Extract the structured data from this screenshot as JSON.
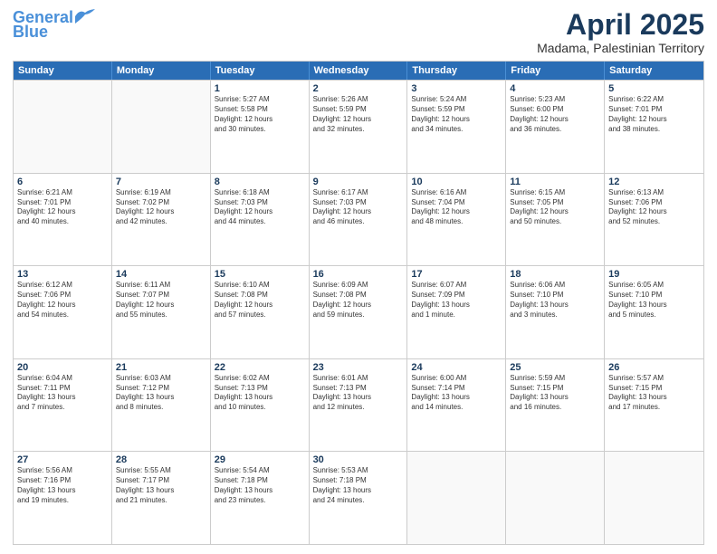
{
  "header": {
    "logo_line1": "General",
    "logo_line2": "Blue",
    "month_year": "April 2025",
    "location": "Madama, Palestinian Territory"
  },
  "days_of_week": [
    "Sunday",
    "Monday",
    "Tuesday",
    "Wednesday",
    "Thursday",
    "Friday",
    "Saturday"
  ],
  "weeks": [
    [
      {
        "day": "",
        "lines": []
      },
      {
        "day": "",
        "lines": []
      },
      {
        "day": "1",
        "lines": [
          "Sunrise: 5:27 AM",
          "Sunset: 5:58 PM",
          "Daylight: 12 hours",
          "and 30 minutes."
        ]
      },
      {
        "day": "2",
        "lines": [
          "Sunrise: 5:26 AM",
          "Sunset: 5:59 PM",
          "Daylight: 12 hours",
          "and 32 minutes."
        ]
      },
      {
        "day": "3",
        "lines": [
          "Sunrise: 5:24 AM",
          "Sunset: 5:59 PM",
          "Daylight: 12 hours",
          "and 34 minutes."
        ]
      },
      {
        "day": "4",
        "lines": [
          "Sunrise: 5:23 AM",
          "Sunset: 6:00 PM",
          "Daylight: 12 hours",
          "and 36 minutes."
        ]
      },
      {
        "day": "5",
        "lines": [
          "Sunrise: 6:22 AM",
          "Sunset: 7:01 PM",
          "Daylight: 12 hours",
          "and 38 minutes."
        ]
      }
    ],
    [
      {
        "day": "6",
        "lines": [
          "Sunrise: 6:21 AM",
          "Sunset: 7:01 PM",
          "Daylight: 12 hours",
          "and 40 minutes."
        ]
      },
      {
        "day": "7",
        "lines": [
          "Sunrise: 6:19 AM",
          "Sunset: 7:02 PM",
          "Daylight: 12 hours",
          "and 42 minutes."
        ]
      },
      {
        "day": "8",
        "lines": [
          "Sunrise: 6:18 AM",
          "Sunset: 7:03 PM",
          "Daylight: 12 hours",
          "and 44 minutes."
        ]
      },
      {
        "day": "9",
        "lines": [
          "Sunrise: 6:17 AM",
          "Sunset: 7:03 PM",
          "Daylight: 12 hours",
          "and 46 minutes."
        ]
      },
      {
        "day": "10",
        "lines": [
          "Sunrise: 6:16 AM",
          "Sunset: 7:04 PM",
          "Daylight: 12 hours",
          "and 48 minutes."
        ]
      },
      {
        "day": "11",
        "lines": [
          "Sunrise: 6:15 AM",
          "Sunset: 7:05 PM",
          "Daylight: 12 hours",
          "and 50 minutes."
        ]
      },
      {
        "day": "12",
        "lines": [
          "Sunrise: 6:13 AM",
          "Sunset: 7:06 PM",
          "Daylight: 12 hours",
          "and 52 minutes."
        ]
      }
    ],
    [
      {
        "day": "13",
        "lines": [
          "Sunrise: 6:12 AM",
          "Sunset: 7:06 PM",
          "Daylight: 12 hours",
          "and 54 minutes."
        ]
      },
      {
        "day": "14",
        "lines": [
          "Sunrise: 6:11 AM",
          "Sunset: 7:07 PM",
          "Daylight: 12 hours",
          "and 55 minutes."
        ]
      },
      {
        "day": "15",
        "lines": [
          "Sunrise: 6:10 AM",
          "Sunset: 7:08 PM",
          "Daylight: 12 hours",
          "and 57 minutes."
        ]
      },
      {
        "day": "16",
        "lines": [
          "Sunrise: 6:09 AM",
          "Sunset: 7:08 PM",
          "Daylight: 12 hours",
          "and 59 minutes."
        ]
      },
      {
        "day": "17",
        "lines": [
          "Sunrise: 6:07 AM",
          "Sunset: 7:09 PM",
          "Daylight: 13 hours",
          "and 1 minute."
        ]
      },
      {
        "day": "18",
        "lines": [
          "Sunrise: 6:06 AM",
          "Sunset: 7:10 PM",
          "Daylight: 13 hours",
          "and 3 minutes."
        ]
      },
      {
        "day": "19",
        "lines": [
          "Sunrise: 6:05 AM",
          "Sunset: 7:10 PM",
          "Daylight: 13 hours",
          "and 5 minutes."
        ]
      }
    ],
    [
      {
        "day": "20",
        "lines": [
          "Sunrise: 6:04 AM",
          "Sunset: 7:11 PM",
          "Daylight: 13 hours",
          "and 7 minutes."
        ]
      },
      {
        "day": "21",
        "lines": [
          "Sunrise: 6:03 AM",
          "Sunset: 7:12 PM",
          "Daylight: 13 hours",
          "and 8 minutes."
        ]
      },
      {
        "day": "22",
        "lines": [
          "Sunrise: 6:02 AM",
          "Sunset: 7:13 PM",
          "Daylight: 13 hours",
          "and 10 minutes."
        ]
      },
      {
        "day": "23",
        "lines": [
          "Sunrise: 6:01 AM",
          "Sunset: 7:13 PM",
          "Daylight: 13 hours",
          "and 12 minutes."
        ]
      },
      {
        "day": "24",
        "lines": [
          "Sunrise: 6:00 AM",
          "Sunset: 7:14 PM",
          "Daylight: 13 hours",
          "and 14 minutes."
        ]
      },
      {
        "day": "25",
        "lines": [
          "Sunrise: 5:59 AM",
          "Sunset: 7:15 PM",
          "Daylight: 13 hours",
          "and 16 minutes."
        ]
      },
      {
        "day": "26",
        "lines": [
          "Sunrise: 5:57 AM",
          "Sunset: 7:15 PM",
          "Daylight: 13 hours",
          "and 17 minutes."
        ]
      }
    ],
    [
      {
        "day": "27",
        "lines": [
          "Sunrise: 5:56 AM",
          "Sunset: 7:16 PM",
          "Daylight: 13 hours",
          "and 19 minutes."
        ]
      },
      {
        "day": "28",
        "lines": [
          "Sunrise: 5:55 AM",
          "Sunset: 7:17 PM",
          "Daylight: 13 hours",
          "and 21 minutes."
        ]
      },
      {
        "day": "29",
        "lines": [
          "Sunrise: 5:54 AM",
          "Sunset: 7:18 PM",
          "Daylight: 13 hours",
          "and 23 minutes."
        ]
      },
      {
        "day": "30",
        "lines": [
          "Sunrise: 5:53 AM",
          "Sunset: 7:18 PM",
          "Daylight: 13 hours",
          "and 24 minutes."
        ]
      },
      {
        "day": "",
        "lines": []
      },
      {
        "day": "",
        "lines": []
      },
      {
        "day": "",
        "lines": []
      }
    ]
  ]
}
